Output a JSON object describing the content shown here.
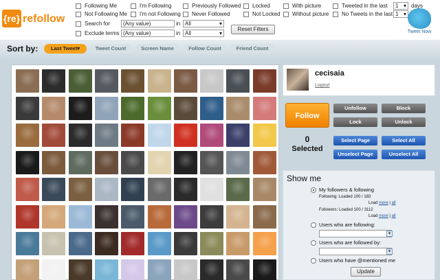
{
  "logo": {
    "bracket": "{re}",
    "name": "refollow"
  },
  "filters": {
    "following_me": "Following Me",
    "not_following_me": "Not Following Me",
    "im_following": "I'm Following",
    "im_not_following": "I'm not Following",
    "previously_followed": "Previously Followed",
    "never_followed": "Never Followed",
    "locked": "Locked",
    "not_locked": "Not Locked",
    "with_picture": "With picture",
    "without_picture": "Without picture",
    "tweeted_in_last": "Tweeted in the last",
    "no_tweets_in_last": "No Tweets in the last",
    "tweeted_value": "1",
    "no_tweets_value": "1",
    "days": "days",
    "search_for": "Search for",
    "exclude_terms": "Exclude terms",
    "search_value": "(Any value)",
    "exclude_value": "(Any value)",
    "in": "in",
    "in_search_value": "All",
    "in_exclude_value": "All",
    "reset": "Reset Filters"
  },
  "tweet_now": "Tweet Now",
  "sort": {
    "label": "Sort by:",
    "tabs": [
      "Last Tweet▾",
      "Tweet Count",
      "Screen Name",
      "Follow Count",
      "Friend Count"
    ]
  },
  "avatars": {
    "colors": [
      "#8a6d52",
      "#2c2c2c",
      "#4a5f36",
      "#555a60",
      "#6b5131",
      "#c9b38d",
      "#7b5a44",
      "#c8c8c8",
      "#4a4f55",
      "#7a3c2a",
      "#3a3a3a",
      "#b58a6a",
      "#1c1c1c",
      "#8fa4b8",
      "#4b6a2b",
      "#6b8e3c",
      "#5a4a3a",
      "#2f5d8a",
      "#a88c6c",
      "#d47a7a",
      "#9a6b3d",
      "#a24a3a",
      "#2b2b2b",
      "#6e7a84",
      "#8b3a28",
      "#c0d7ea",
      "#d03020",
      "#b04a7a",
      "#3b3f6a",
      "#f2c84a",
      "#1a1a1a",
      "#7d5a3c",
      "#5f6b5f",
      "#6a4e3c",
      "#4a4a4a",
      "#e3d4b0",
      "#222222",
      "#555555",
      "#808a94",
      "#a05a3a",
      "#c05a4a",
      "#3a4a5a",
      "#7a6040",
      "#aab8c4",
      "#304050",
      "#6a6a6a",
      "#2a2a2a",
      "#e0e0e0",
      "#5a6a4a",
      "#a88866",
      "#b0362c",
      "#d4a87a",
      "#9bb9d6",
      "#3a3030",
      "#4a5a6a",
      "#b86a3a",
      "#6c4a8a",
      "#3c3c3c",
      "#d4b490",
      "#8a6a4a",
      "#4a7a9a",
      "#c7c2b0",
      "#4a6a8a",
      "#3a2a20",
      "#a22a2a",
      "#5a9ac8",
      "#3a3a3a",
      "#8a8a5a",
      "#c89a6a",
      "#f5a04a",
      "#c4a078",
      "#f2f2f2",
      "#4a3a2a",
      "#7ab6d6",
      "#d4c8e8",
      "#8aa4bc",
      "#c8c8c8",
      "#2a2a2a",
      "#4a4a4a",
      "#1a1a1a"
    ]
  },
  "user": {
    "name": "cecisaia",
    "logout": "Logout"
  },
  "actions": {
    "follow": "Follow",
    "unfollow": "Unfollow",
    "block": "Block",
    "lock": "Lock",
    "unlock": "Unlock",
    "count": "0",
    "selected": "Selected",
    "select_page": "Select Page",
    "select_all": "Select All",
    "unselect_page": "Unselect Page",
    "unselect_all": "Unselect All"
  },
  "show_me": {
    "title": "Show me",
    "opt1": "My followers & following",
    "following_loaded": "Following: Loaded 100 / 183",
    "followers_loaded": "Followers: Loaded 100 / 3112",
    "load": "Load",
    "more": "more",
    "sep": "|",
    "all": "all",
    "opt2": "Users who are following:",
    "opt3": "Users who are followed by:",
    "opt4": "Users who have @mentioned me",
    "update": "Update"
  }
}
